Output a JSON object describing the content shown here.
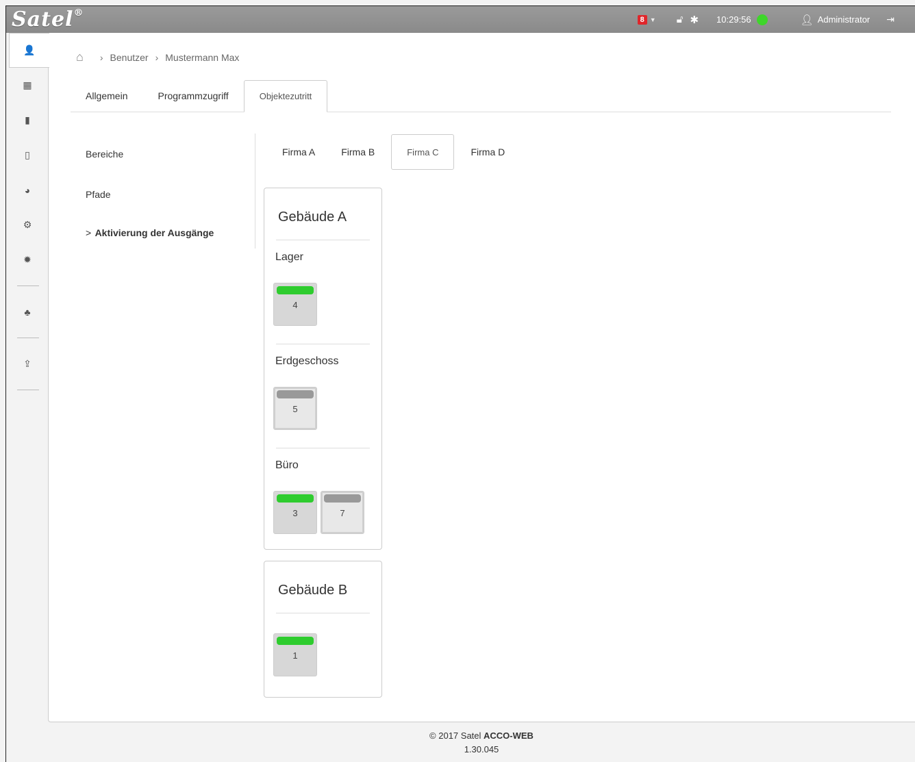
{
  "topbar": {
    "logo": "Satel",
    "logo_mark": "®",
    "alarm_count": "8",
    "time": "10:29:56",
    "user": "Administrator",
    "status_color": "#3ed62a",
    "alarm_color": "#e0262b"
  },
  "leftnav": {
    "items": [
      {
        "icon": "user-icon",
        "glyph": "👤"
      },
      {
        "icon": "calendar-icon",
        "glyph": "▦"
      },
      {
        "icon": "document-icon",
        "glyph": "▮"
      },
      {
        "icon": "copy-icon",
        "glyph": "▯"
      },
      {
        "icon": "globe-icon",
        "glyph": "◕"
      },
      {
        "icon": "gears-icon",
        "glyph": "⚙"
      },
      {
        "icon": "settings-icon",
        "glyph": "✹"
      },
      {
        "icon": "cubes-icon",
        "glyph": "♣"
      },
      {
        "icon": "upload-icon",
        "glyph": "⇪"
      }
    ]
  },
  "breadcrumb": {
    "items": [
      "Benutzer",
      "Mustermann Max"
    ]
  },
  "tabs": {
    "items": [
      "Allgemein",
      "Programmzugriff",
      "Objektezutritt"
    ],
    "active": 2
  },
  "subnav": {
    "items": [
      "Bereiche",
      "Pfade",
      "Aktivierung der Ausgänge"
    ],
    "active_caret": ">"
  },
  "firma_tabs": {
    "items": [
      "Firma A",
      "Firma B",
      "Firma C",
      "Firma D"
    ],
    "active": 2
  },
  "buildings": [
    {
      "title": "Gebäude A",
      "areas": [
        {
          "label": "Lager",
          "doors": [
            {
              "number": "4",
              "status_color": "#2ecc2e"
            }
          ]
        },
        {
          "label": "Erdgeschoss",
          "doors": [
            {
              "number": "5",
              "status_color": "#999999"
            }
          ]
        },
        {
          "label": "Büro",
          "doors": [
            {
              "number": "3",
              "status_color": "#2ecc2e"
            },
            {
              "number": "7",
              "status_color": "#999999"
            }
          ]
        }
      ]
    },
    {
      "title": "Gebäude B",
      "doors": [
        {
          "number": "1",
          "status_color": "#2ecc2e"
        }
      ]
    }
  ],
  "footer": {
    "copyright": "© 2017 Satel ",
    "product": "ACCO-WEB",
    "version": "1.30.045"
  }
}
